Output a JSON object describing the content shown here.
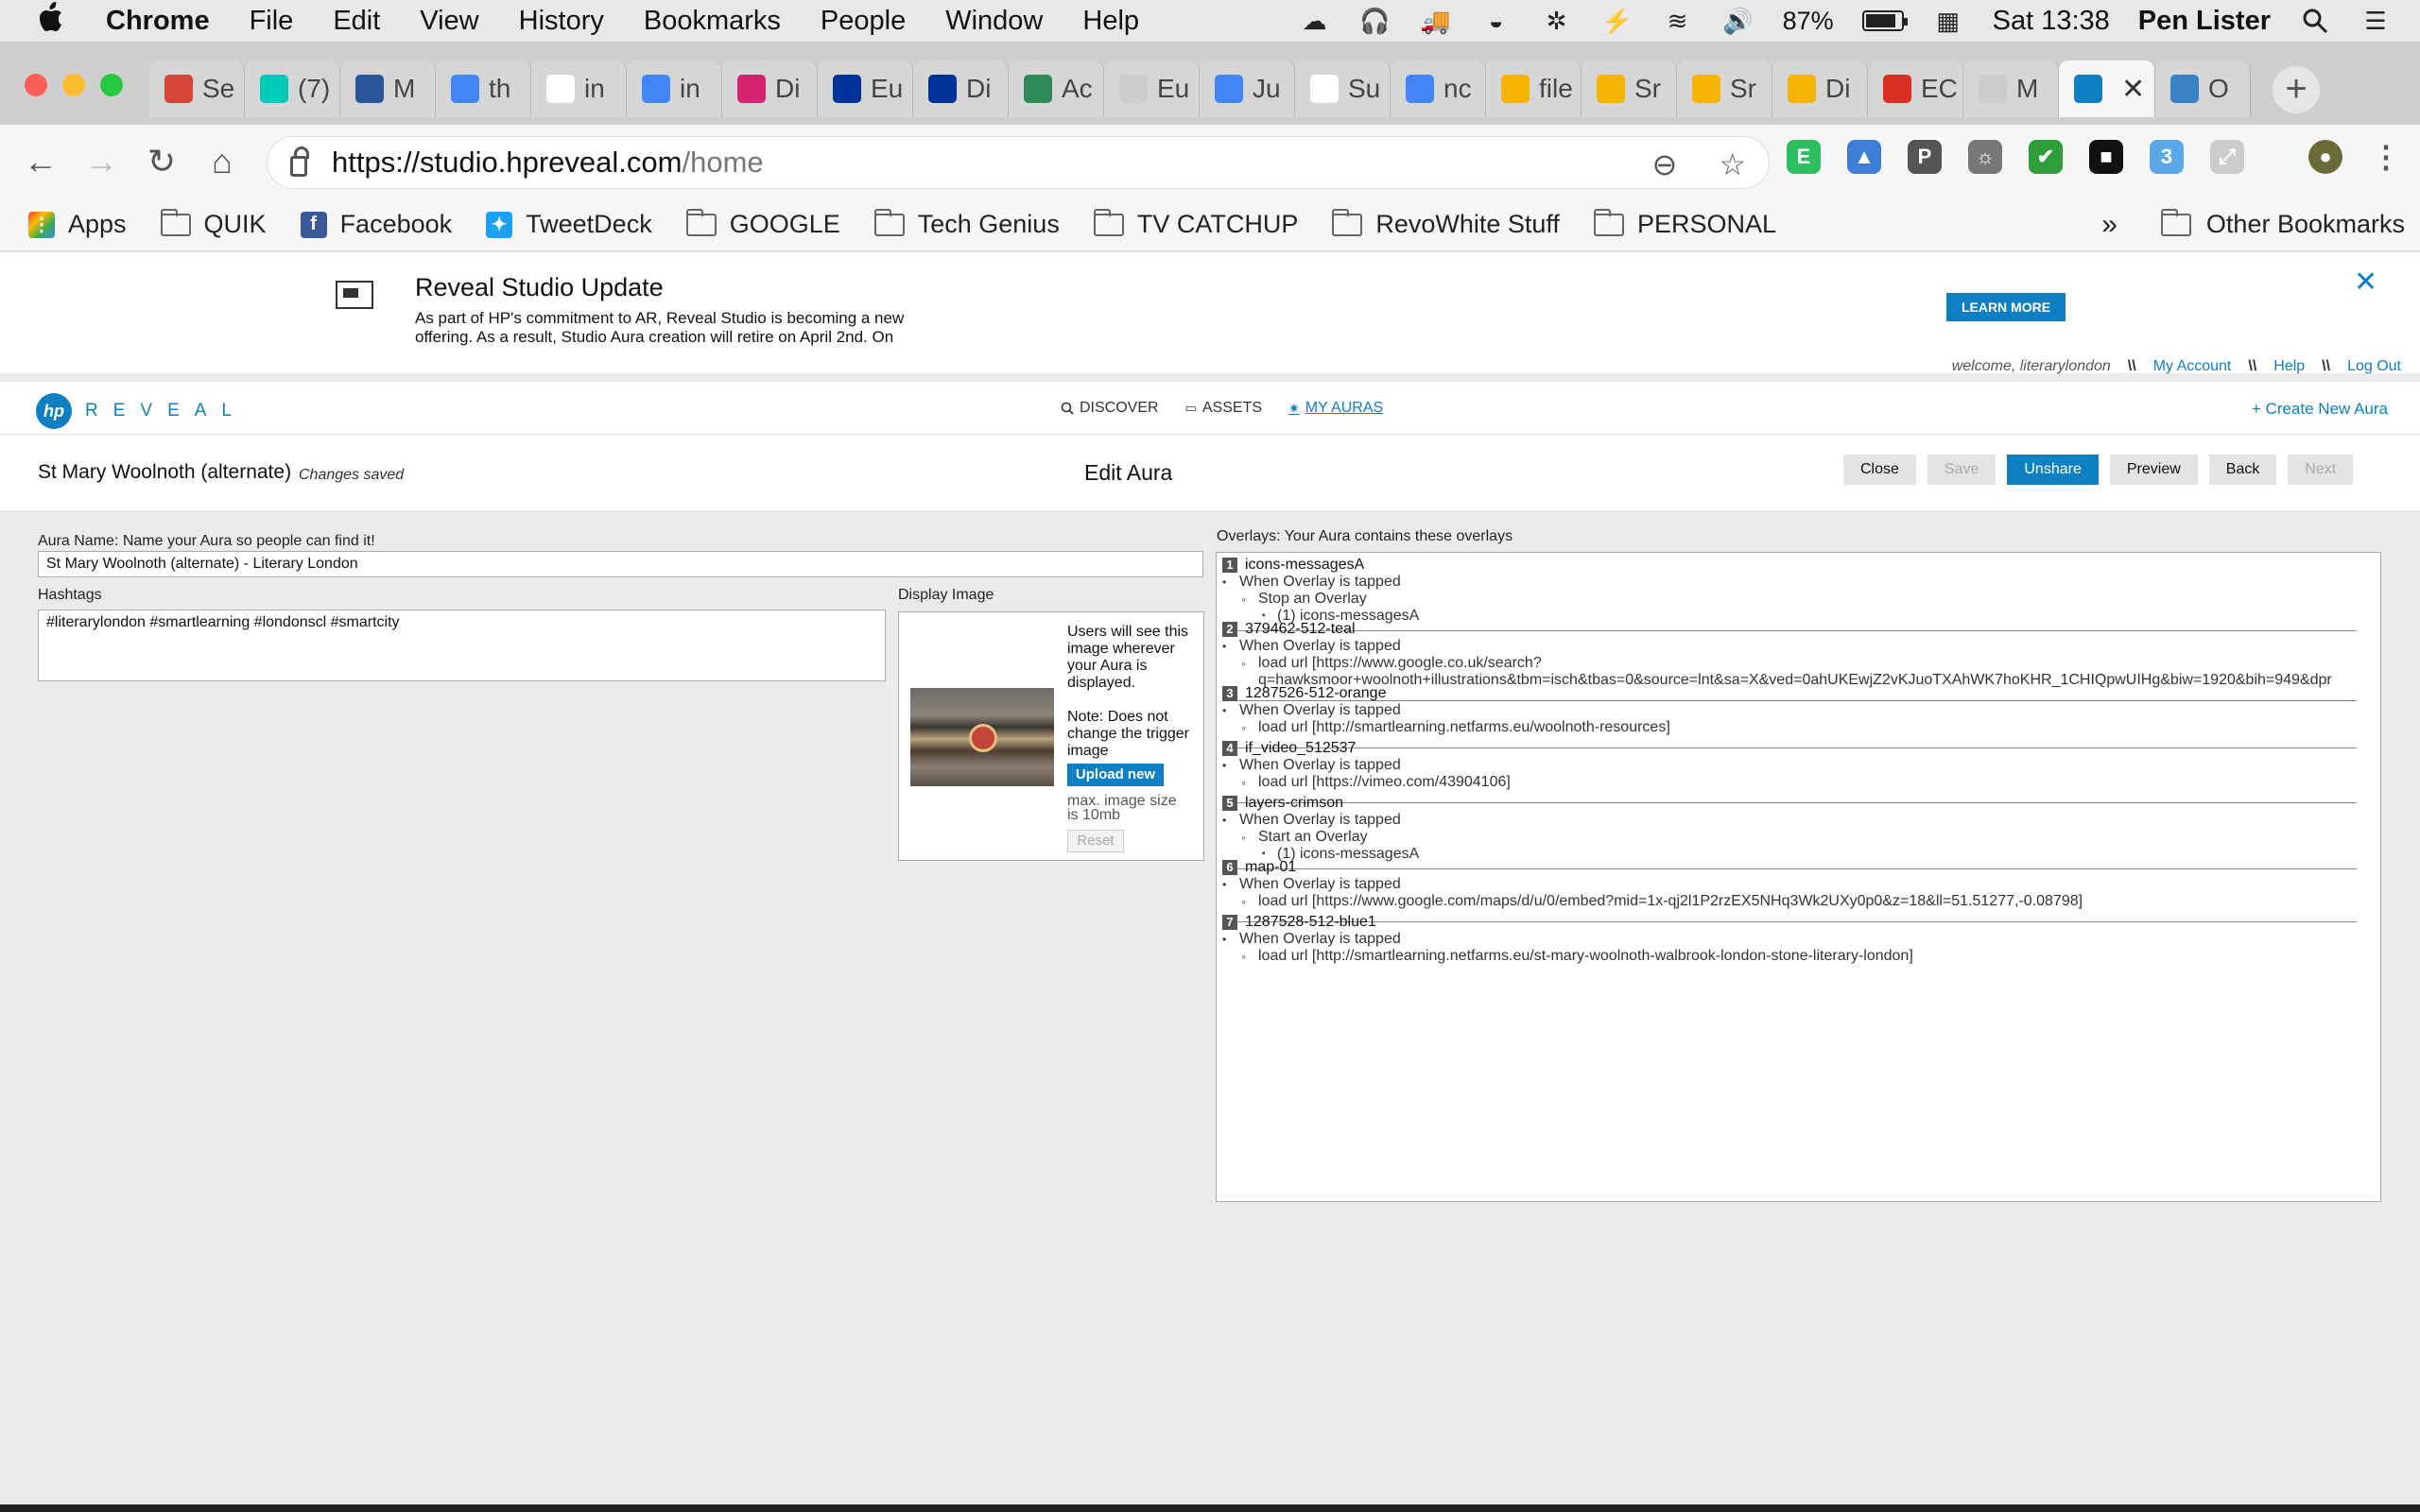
{
  "menubar": {
    "app": "Chrome",
    "items": [
      "File",
      "Edit",
      "View",
      "History",
      "Bookmarks",
      "People",
      "Window",
      "Help"
    ],
    "battery": "87%",
    "clock": "Sat 13:38",
    "user": "Pen Lister"
  },
  "tabs": [
    {
      "label": "Se",
      "icon": "gmail-icon",
      "color": "#d44638"
    },
    {
      "label": "(7)",
      "icon": "researchgate-icon",
      "color": "#00ccbb"
    },
    {
      "label": "M",
      "icon": "grid-icon",
      "color": "#2a5699"
    },
    {
      "label": "th",
      "icon": "translate-icon",
      "color": "#4285f4"
    },
    {
      "label": "in",
      "icon": "google-icon",
      "color": "#ffffff"
    },
    {
      "label": "in",
      "icon": "translate-icon",
      "color": "#4285f4"
    },
    {
      "label": "Di",
      "icon": "m-icon",
      "color": "#d6246e"
    },
    {
      "label": "Eu",
      "icon": "eu-flag-icon",
      "color": "#003399"
    },
    {
      "label": "Di",
      "icon": "eu-flag-icon",
      "color": "#003399"
    },
    {
      "label": "Ac",
      "icon": "g20-icon",
      "color": "#2e8b57"
    },
    {
      "label": "Eu",
      "icon": "document-icon",
      "color": "#cccccc"
    },
    {
      "label": "Ju",
      "icon": "docs-icon",
      "color": "#4285f4"
    },
    {
      "label": "Su",
      "icon": "wikipedia-icon",
      "color": "#ffffff"
    },
    {
      "label": "nc",
      "icon": "translate-icon",
      "color": "#4285f4"
    },
    {
      "label": "file",
      "icon": "drive-icon",
      "color": "#f4b400"
    },
    {
      "label": "Sr",
      "icon": "slides-icon",
      "color": "#f4b400"
    },
    {
      "label": "Sr",
      "icon": "slides-icon",
      "color": "#f4b400"
    },
    {
      "label": "Di",
      "icon": "slides-icon",
      "color": "#f4b400"
    },
    {
      "label": "EC",
      "icon": "pdf-icon",
      "color": "#d93025"
    },
    {
      "label": "M",
      "icon": "document-icon",
      "color": "#cccccc"
    },
    {
      "label": "",
      "icon": "reveal-icon",
      "color": "#0d7fc2",
      "active": true
    },
    {
      "label": "O",
      "icon": "cloud-icon",
      "color": "#3b82c4"
    }
  ],
  "omnibox": {
    "host": "https://studio.hpreveal.com",
    "path": "/home"
  },
  "bookmarks": [
    {
      "label": "Apps",
      "type": "apps"
    },
    {
      "label": "QUIK",
      "type": "folder"
    },
    {
      "label": "Facebook",
      "type": "facebook"
    },
    {
      "label": "TweetDeck",
      "type": "twitter"
    },
    {
      "label": "GOOGLE",
      "type": "folder"
    },
    {
      "label": "Tech Genius",
      "type": "folder"
    },
    {
      "label": "TV CATCHUP",
      "type": "folder"
    },
    {
      "label": "RevoWhite Stuff",
      "type": "folder"
    },
    {
      "label": "PERSONAL",
      "type": "folder"
    }
  ],
  "bookmarks_overflow": "»",
  "bookmarks_other": "Other Bookmarks",
  "banner": {
    "title": "Reveal Studio Update",
    "text": "As part of HP's commitment to AR, Reveal Studio is becoming a new offering. As a result, Studio Aura creation will retire on April 2nd. On",
    "button": "LEARN MORE"
  },
  "userbar": {
    "welcome": "welcome, literarylondon",
    "sep": "\\\\",
    "links": [
      "My Account",
      "Help",
      "Log Out"
    ]
  },
  "nav": {
    "brand": "REVEAL",
    "logo": "hp",
    "items": [
      "DISCOVER",
      "ASSETS",
      "MY AURAS"
    ],
    "create": "+ Create New Aura"
  },
  "edit": {
    "aura_title": "St Mary Woolnoth (alternate)",
    "status": "Changes saved",
    "heading": "Edit Aura",
    "buttons": [
      "Close",
      "Save",
      "Unshare",
      "Preview",
      "Back",
      "Next"
    ]
  },
  "form": {
    "name_label": "Aura Name: Name your Aura so people can find it!",
    "name_value": "St Mary Woolnoth (alternate) - Literary London",
    "hashtags_label": "Hashtags",
    "hashtags_value": "#literarylondon #smartlearning #londonscl #smartcity",
    "display_label": "Display Image",
    "display_text1": "Users will see this image wherever your Aura is displayed.",
    "display_text2": "Note: Does not change the trigger image",
    "upload": "Upload new",
    "maxsize": "max. image size is 10mb",
    "reset": "Reset"
  },
  "overlays_label": "Overlays: Your Aura contains these overlays",
  "overlays": [
    {
      "n": "1",
      "name": "icons-messagesA",
      "trigger": "When Overlay is tapped",
      "action": "Stop an Overlay",
      "sub": "(1) icons-messagesA"
    },
    {
      "n": "2",
      "name": "379462-512-teal",
      "trigger": "When Overlay is tapped",
      "action": "load url [https://www.google.co.uk/search?\nq=hawksmoor+woolnoth+illustrations&tbm=isch&tbas=0&source=lnt&sa=X&ved=0ahUKEwjZ2vKJuoTXAhWK7hoKHR_1CHIQpwUIHg&biw=1920&bih=949&dpr",
      "sub": ""
    },
    {
      "n": "3",
      "name": "1287526-512-orange",
      "trigger": "When Overlay is tapped",
      "action": "load url [http://smartlearning.netfarms.eu/woolnoth-resources]",
      "sub": ""
    },
    {
      "n": "4",
      "name": "if_video_512537",
      "trigger": "When Overlay is tapped",
      "action": "load url [https://vimeo.com/43904106]",
      "sub": ""
    },
    {
      "n": "5",
      "name": "layers-crimson",
      "trigger": "When Overlay is tapped",
      "action": "Start an Overlay",
      "sub": "(1) icons-messagesA"
    },
    {
      "n": "6",
      "name": "map-01",
      "trigger": "When Overlay is tapped",
      "action": "load url [https://www.google.com/maps/d/u/0/embed?mid=1x-qj2l1P2rzEX5NHq3Wk2UXy0p0&z=18&ll=51.51277,-0.08798]",
      "sub": ""
    },
    {
      "n": "7",
      "name": "1287528-512-blue1",
      "trigger": "When Overlay is tapped",
      "action": "load url [http://smartlearning.netfarms.eu/st-mary-woolnoth-walbrook-london-stone-literary-london]",
      "sub": ""
    }
  ],
  "colors": {
    "accent": "#0d7fc2"
  }
}
